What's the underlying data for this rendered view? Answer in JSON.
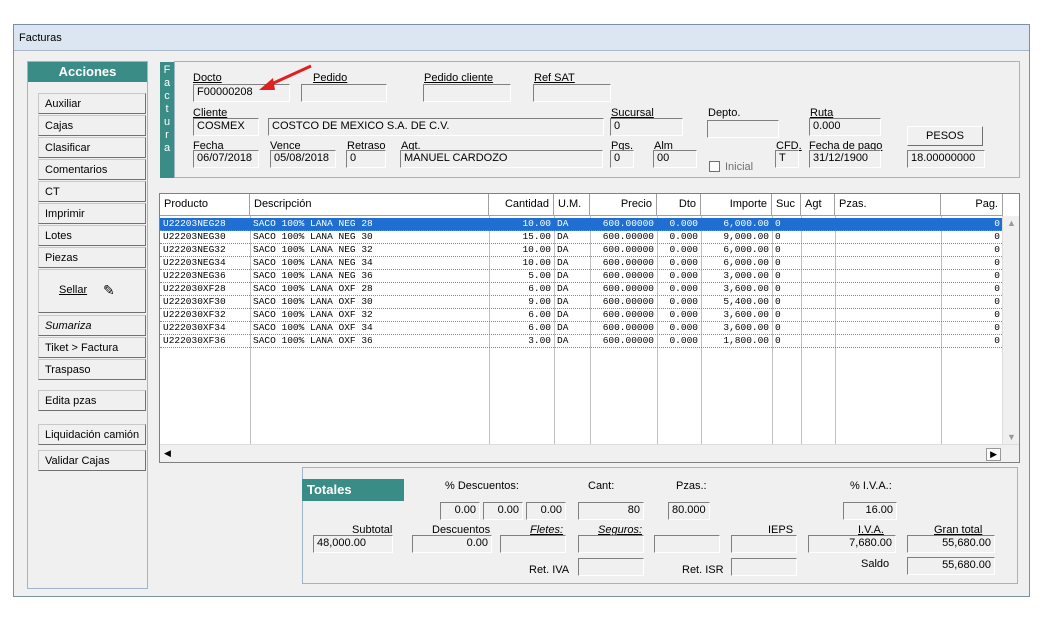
{
  "window": {
    "title": "Facturas"
  },
  "acciones": {
    "title": "Acciones",
    "buttons": [
      "Auxiliar",
      "Cajas",
      "Clasificar",
      "Comentarios",
      "CT",
      "Imprimir",
      "Lotes",
      "Piezas"
    ],
    "sellar": "Sellar",
    "sumariza": "Sumariza",
    "buttons2": [
      "Tiket > Factura",
      "Traspaso"
    ],
    "edita": "Edita pzas",
    "liquidacion": "Liquidación camión",
    "validar": "Validar Cajas"
  },
  "factura_tab": [
    "F",
    "a",
    "c",
    "t",
    "u",
    "r",
    "a"
  ],
  "header": {
    "docto_label": "Docto",
    "docto": "F00000208",
    "pedido_label": "Pedido",
    "pedido": "",
    "pedido_cliente_label": "Pedido cliente",
    "pedido_cliente": "",
    "ref_sat_label": "Ref SAT",
    "ref_sat": "",
    "cliente_label": "Cliente",
    "cliente": "COSMEX",
    "cliente_nombre": "COSTCO DE MEXICO S.A. DE C.V.",
    "sucursal_label": "Sucursal",
    "sucursal": "0",
    "depto_label": "Depto.",
    "depto": "",
    "ruta_label": "Ruta",
    "ruta": "0.000",
    "moneda": "PESOS",
    "fecha_label": "Fecha",
    "fecha": "06/07/2018",
    "vence_label": "Vence",
    "vence": "05/08/2018",
    "retraso_label": "Retraso",
    "retraso": "0",
    "agt_label": "Agt.",
    "agt": "MANUEL CARDOZO",
    "pgs_label": "Pgs.",
    "pgs": "0",
    "alm_label": "Alm",
    "alm": "00",
    "inicial_label": "Inicial",
    "cfd_label": "CFD.",
    "cfd": "T",
    "fecha_pago_label": "Fecha de pago",
    "fecha_pago": "31/12/1900",
    "tipo_cambio": "18.00000000"
  },
  "grid": {
    "columns": [
      "Producto",
      "Descripción",
      "Cantidad",
      "U.M.",
      "Precio",
      "Dto",
      "Importe",
      "Suc",
      "Agt",
      "Pzas.",
      "Pag."
    ],
    "rows": [
      [
        "U22203NEG28",
        "SACO 100% LANA NEG 28",
        "10.00",
        "DA",
        "600.00000",
        "0.000",
        "6,000.00",
        "0",
        "",
        "",
        "0"
      ],
      [
        "U22203NEG30",
        "SACO 100% LANA NEG 30",
        "15.00",
        "DA",
        "600.00000",
        "0.000",
        "9,000.00",
        "0",
        "",
        "",
        "0"
      ],
      [
        "U22203NEG32",
        "SACO 100% LANA NEG 32",
        "10.00",
        "DA",
        "600.00000",
        "0.000",
        "6,000.00",
        "0",
        "",
        "",
        "0"
      ],
      [
        "U22203NEG34",
        "SACO 100% LANA NEG 34",
        "10.00",
        "DA",
        "600.00000",
        "0.000",
        "6,000.00",
        "0",
        "",
        "",
        "0"
      ],
      [
        "U22203NEG36",
        "SACO 100% LANA NEG 36",
        "5.00",
        "DA",
        "600.00000",
        "0.000",
        "3,000.00",
        "0",
        "",
        "",
        "0"
      ],
      [
        "U222030XF28",
        "SACO 100% LANA OXF 28",
        "6.00",
        "DA",
        "600.00000",
        "0.000",
        "3,600.00",
        "0",
        "",
        "",
        "0"
      ],
      [
        "U222030XF30",
        "SACO 100% LANA OXF 30",
        "9.00",
        "DA",
        "600.00000",
        "0.000",
        "5,400.00",
        "0",
        "",
        "",
        "0"
      ],
      [
        "U222030XF32",
        "SACO 100% LANA OXF 32",
        "6.00",
        "DA",
        "600.00000",
        "0.000",
        "3,600.00",
        "0",
        "",
        "",
        "0"
      ],
      [
        "U222030XF34",
        "SACO 100% LANA OXF 34",
        "6.00",
        "DA",
        "600.00000",
        "0.000",
        "3,600.00",
        "0",
        "",
        "",
        "0"
      ],
      [
        "U222030XF36",
        "SACO 100% LANA OXF 36",
        "3.00",
        "DA",
        "600.00000",
        "0.000",
        "1,800.00",
        "0",
        "",
        "",
        "0"
      ]
    ]
  },
  "totales": {
    "title": "Totales",
    "descuentos_pct_label": "% Descuentos:",
    "desc1": "0.00",
    "desc2": "0.00",
    "desc3": "0.00",
    "cant_label": "Cant:",
    "cant": "80",
    "pzas_label": "Pzas.:",
    "pzas": "80.000",
    "iva_pct_label": "% I.V.A.:",
    "iva_pct": "16.00",
    "subtotal_label": "Subtotal",
    "subtotal": "48,000.00",
    "descuentos_label": "Descuentos",
    "descuentos": "0.00",
    "fletes_label": "Fletes:",
    "fletes": "",
    "seguros_label": "Seguros:",
    "seguros": "",
    "otros": "",
    "ieps_label": "IEPS",
    "ieps": "",
    "iva_label": "I.V.A.",
    "iva": "7,680.00",
    "gran_total_label": "Gran total",
    "gran_total": "55,680.00",
    "ret_iva_label": "Ret. IVA",
    "ret_iva": "",
    "ret_isr_label": "Ret. ISR",
    "ret_isr": "",
    "saldo_label": "Saldo",
    "saldo": "55,680.00"
  },
  "colors": {
    "accent": "#3a8c86",
    "selected": "#1e6fd1",
    "arrow": "#e02020"
  }
}
